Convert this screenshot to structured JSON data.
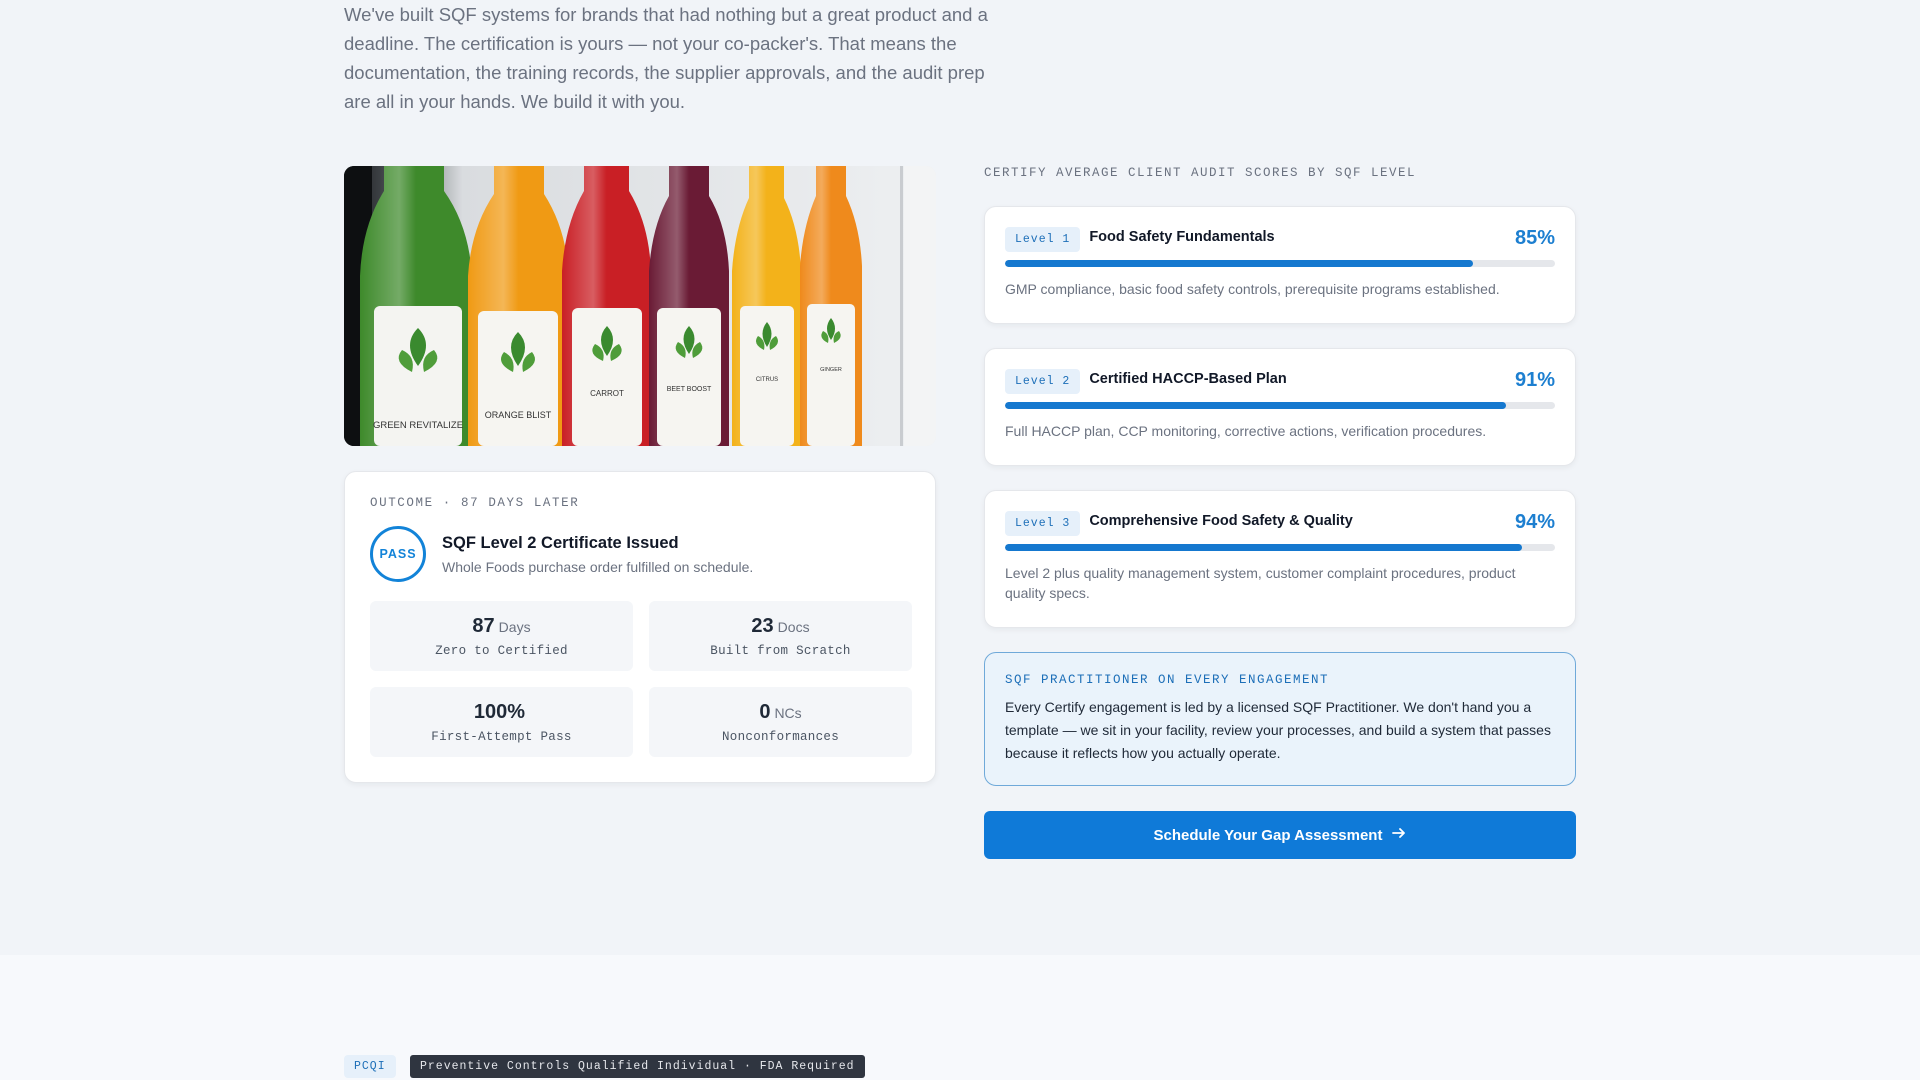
{
  "intro": {
    "text": "We've built SQF systems for brands that had nothing but a great product and a deadline. The certification is yours — not your co-packer's. That means the documentation, the training records, the supplier approvals, and the audit prep are all in your hands. We build it with you."
  },
  "photo": {
    "bottle_labels": [
      "GREEN REVITALIZE",
      "ORANGE BLIST",
      "CARROT",
      "BEET BOOST",
      "CITRUS",
      "GINGER"
    ]
  },
  "outcome": {
    "eyebrow": "OUTCOME · 87 DAYS LATER",
    "badge": "PASS",
    "title": "SQF Level 2 Certificate Issued",
    "subtitle": "Whole Foods purchase order fulfilled on schedule.",
    "stats": [
      {
        "num": "87",
        "unit": "Days",
        "label": "Zero to Certified"
      },
      {
        "num": "23",
        "unit": "Docs",
        "label": "Built from Scratch"
      },
      {
        "num": "100%",
        "unit": "",
        "label": "First-Attempt Pass"
      },
      {
        "num": "0",
        "unit": "NCs",
        "label": "Nonconformances"
      }
    ]
  },
  "scores": {
    "section_label": "CERTIFY AVERAGE CLIENT AUDIT SCORES BY SQF LEVEL",
    "levels": [
      {
        "tag": "Level 1",
        "title": "Food Safety Fundamentals",
        "pct_label": "85%",
        "value": 85,
        "desc": "GMP compliance, basic food safety controls, prerequisite programs established."
      },
      {
        "tag": "Level 2",
        "title": "Certified HACCP-Based Plan",
        "pct_label": "91%",
        "value": 91,
        "desc": "Full HACCP plan, CCP monitoring, corrective actions, verification procedures."
      },
      {
        "tag": "Level 3",
        "title": "Comprehensive Food Safety & Quality",
        "pct_label": "94%",
        "value": 94,
        "desc": "Level 2 plus quality management system, customer complaint procedures, product quality specs."
      }
    ]
  },
  "practitioner": {
    "title": "SQF PRACTITIONER ON EVERY ENGAGEMENT",
    "body": "Every Certify engagement is led by a licensed SQF Practitioner. We don't hand you a template — we sit in your facility, review your processes, and build a system that passes because it reflects how you actually operate."
  },
  "cta": {
    "label": "Schedule Your Gap Assessment",
    "icon": "arrow-right-icon"
  },
  "pcqi": {
    "tag": "PCQI",
    "chip": "Preventive Controls Qualified Individual · FDA Required"
  },
  "colors": {
    "accent": "#1283d8",
    "cta": "#0f7ad8",
    "bar": "#1578cf",
    "page_bg": "#f1f4f8"
  }
}
